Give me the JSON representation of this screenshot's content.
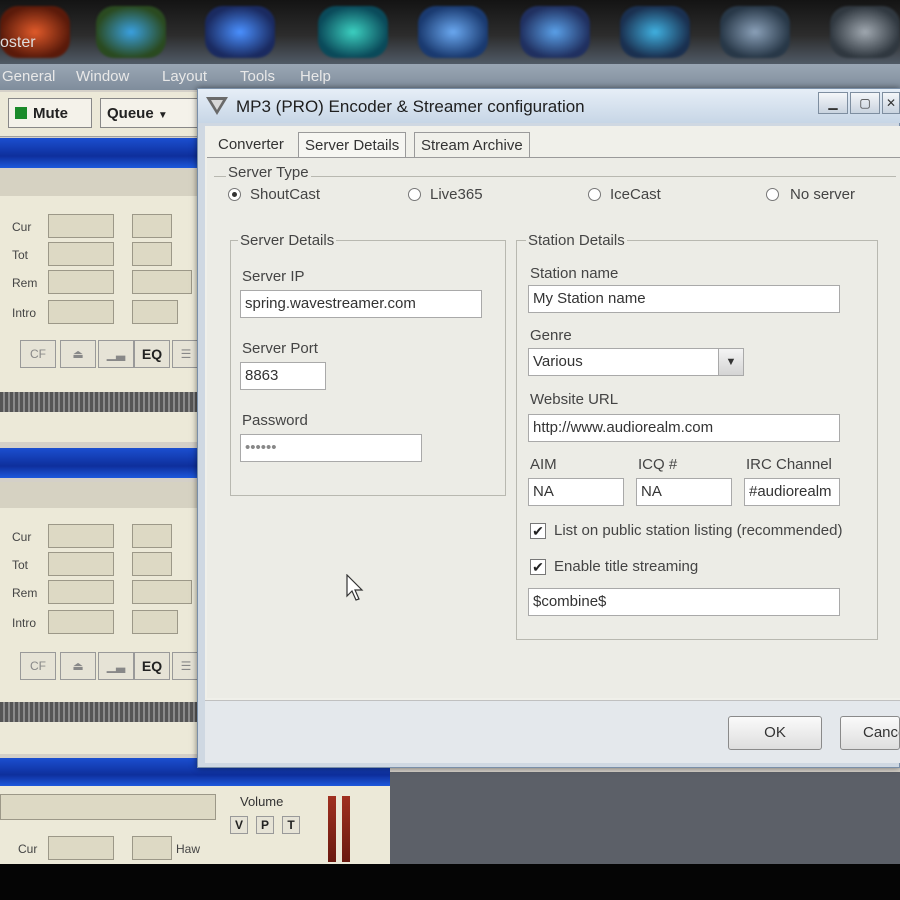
{
  "taskbar": {
    "fragment_text": "oster"
  },
  "host": {
    "menu": [
      "General",
      "Window",
      "Layout",
      "Tools",
      "Help"
    ],
    "toolbar": {
      "mute": "Mute",
      "queue": "Queue"
    },
    "deck_rows": [
      "Cur",
      "Tot",
      "Rem",
      "Intro"
    ],
    "deck_eq": "EQ",
    "deck_cf": "CF",
    "volume_label": "Volume",
    "vpt": [
      "V",
      "P",
      "T"
    ],
    "bottom_row": "Cur",
    "bottom_row_right": "Haw"
  },
  "dialog": {
    "title": "MP3 (PRO) Encoder & Streamer configuration",
    "tabs": [
      "Converter",
      "Server Details",
      "Stream Archive"
    ],
    "server_type": {
      "label": "Server Type",
      "options": [
        "ShoutCast",
        "Live365",
        "IceCast",
        "No server"
      ],
      "selected": "ShoutCast"
    },
    "server_details": {
      "label": "Server Details",
      "ip_label": "Server IP",
      "ip_value": "spring.wavestreamer.com",
      "port_label": "Server Port",
      "port_value": "8863",
      "password_label": "Password",
      "password_value": "••••••"
    },
    "station_details": {
      "label": "Station Details",
      "name_label": "Station name",
      "name_value": "My Station name",
      "genre_label": "Genre",
      "genre_value": "Various",
      "website_label": "Website URL",
      "website_value": "http://www.audiorealm.com",
      "aim_label": "AIM",
      "aim_value": "NA",
      "icq_label": "ICQ #",
      "icq_value": "NA",
      "irc_label": "IRC Channel",
      "irc_value": "#audiorealm",
      "list_public_label": "List on public station listing (recommended)",
      "list_public_checked": true,
      "title_streaming_label": "Enable title streaming",
      "title_streaming_checked": true,
      "title_format_value": "$combine$"
    },
    "buttons": {
      "ok": "OK",
      "cancel": "Cancel"
    }
  }
}
